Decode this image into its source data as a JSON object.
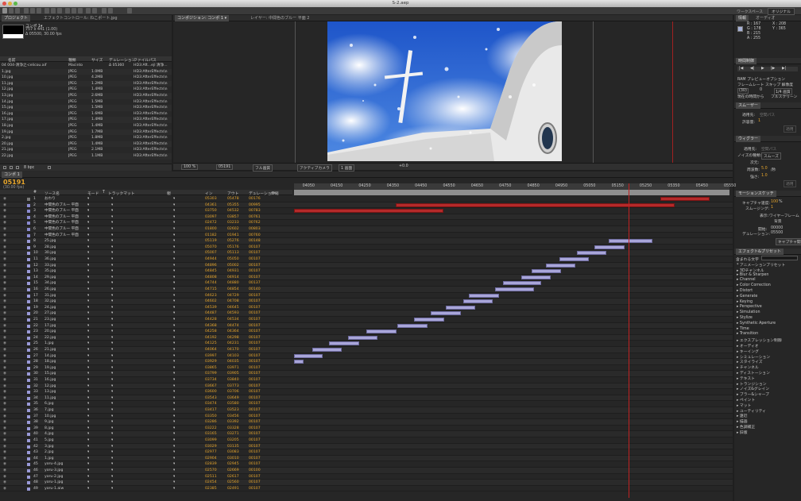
{
  "window": {
    "title": "S-2.aep"
  },
  "workspace": {
    "label": "ワークスペース",
    "value": "オリジナル"
  },
  "project_panel": {
    "tabs": [
      "プロジェクト",
      "エフェクトコントロール: ねこポート.jpg"
    ],
    "comp_name": "コンポ 1▾",
    "comp_size": "757 x 441 (1.00)",
    "comp_duration": "Δ 05500, 30.00 fps",
    "columns": [
      "名前",
      "種類",
      "サイズ",
      "デュレーション",
      "ファイルパス"
    ],
    "items": [
      {
        "name": "04 004-清浄之-celicou.aif",
        "type": "Macinto",
        "size": "  ",
        "dur": "Δ 05360",
        "path": "HD3:Aft...ejl 清浄..."
      },
      {
        "name": "1.jpg",
        "type": "JPEG",
        "size": "1.0MB",
        "dur": "",
        "path": "HD3:AfterEffects\\n"
      },
      {
        "name": "10.jpg",
        "type": "JPEG",
        "size": "4.2MB",
        "dur": "",
        "path": "HD3:AfterEffects\\n"
      },
      {
        "name": "11.jpg",
        "type": "JPEG",
        "size": "1.2MB",
        "dur": "",
        "path": "HD3:AfterEffects\\n"
      },
      {
        "name": "12.jpg",
        "type": "JPEG",
        "size": "1.4MB",
        "dur": "",
        "path": "HD3:AfterEffects\\n"
      },
      {
        "name": "13.jpg",
        "type": "JPEG",
        "size": "2.6MB",
        "dur": "",
        "path": "HD3:AfterEffects\\n"
      },
      {
        "name": "14.jpg",
        "type": "JPEG",
        "size": "1.5MB",
        "dur": "",
        "path": "HD3:AfterEffects\\n"
      },
      {
        "name": "15.jpg",
        "type": "JPEG",
        "size": "1.5MB",
        "dur": "",
        "path": "HD3:AfterEffects\\n"
      },
      {
        "name": "16.jpg",
        "type": "JPEG",
        "size": "1.6MB",
        "dur": "",
        "path": "HD3:AfterEffects\\n"
      },
      {
        "name": "17.jpg",
        "type": "JPEG",
        "size": "1.4MB",
        "dur": "",
        "path": "HD3:AfterEffects\\n"
      },
      {
        "name": "18.jpg",
        "type": "JPEG",
        "size": "1.4MB",
        "dur": "",
        "path": "HD3:AfterEffects\\n"
      },
      {
        "name": "19.jpg",
        "type": "JPEG",
        "size": "1.7MB",
        "dur": "",
        "path": "HD3:AfterEffects\\n"
      },
      {
        "name": "2.jpg",
        "type": "JPEG",
        "size": "1.8MB",
        "dur": "",
        "path": "HD3:AfterEffects\\n"
      },
      {
        "name": "20.jpg",
        "type": "JPEG",
        "size": "1.4MB",
        "dur": "",
        "path": "HD3:AfterEffects\\n"
      },
      {
        "name": "21.jpg",
        "type": "JPEG",
        "size": "2.1MB",
        "dur": "",
        "path": "HD3:AfterEffects\\n"
      },
      {
        "name": "22.jpg",
        "type": "JPEG",
        "size": "1.1MB",
        "dur": "",
        "path": "HD3:AfterEffects\\n"
      }
    ],
    "footer": "8 bpc"
  },
  "viewer": {
    "tabs": [
      "コンポジション: コンポ 1 ▾",
      "レイヤー: 中間色のブルー 平面 2"
    ],
    "zoom": "100 %",
    "timecode": "05191",
    "quality": "フル画質",
    "camera": "アクティブカメラ",
    "views": "1 画面",
    "exposure": "+0.0"
  },
  "info_panel": {
    "tabs": [
      "情報",
      "オーディオ"
    ],
    "r": "R : 167",
    "g": "G : 178",
    "b": "B : 215",
    "a": "A : 255",
    "x": "X : 208",
    "y": "Y : 365",
    "swatch": "#a7b2d7"
  },
  "time_panel": {
    "title": "時間制御",
    "ram_preview": "RAM プレビューオプション",
    "framerate_label": "フレームレート スキップ 解像度",
    "fr_value": "(30)",
    "skip_value": "0",
    "res_value": "1/4 画質",
    "current_time": "現在の時間から",
    "fullscreen": "フルスクリーン"
  },
  "smoother": {
    "title": "スムーザー",
    "apply_label": "適用先:",
    "apply_value": "空間パス",
    "tolerance_label": "許容量:",
    "tolerance_value": "1",
    "apply_btn": "適用"
  },
  "wiggler": {
    "title": "ウィグラー",
    "apply_to": "適用先:",
    "apply_to_value": "空間パス",
    "noise_type": "ノイズの種類:",
    "noise_value": "スムーズ",
    "dimension": "次元:",
    "freq_label": "周波数:",
    "freq_value": "5.0",
    "freq_unit": "/秒",
    "magnitude_label": "強さ:",
    "magnitude_value": "1.0",
    "apply_btn": "適用"
  },
  "motion_sketch": {
    "title": "モーションスケッチ",
    "capture_speed": "キャプチャ速度:",
    "capture_value": "100",
    "capture_unit": "%",
    "smoothing": "スムージング:",
    "smoothing_value": "1",
    "show": "表示:",
    "wireframe": "ワイヤーフレーム",
    "background": "背景",
    "start": "開始:",
    "start_value": "00000",
    "duration": "デュレーション:",
    "duration_value": "05500",
    "start_capture": "キャプチャ開始"
  },
  "effects_panel": {
    "title": "エフェクト&プリセット",
    "search_label": "含まれる文字",
    "items": [
      "* アニメーションプリセット",
      "▸ 3Dチャンネル",
      "▸ Blur & Sharpen",
      "▸ Channel",
      "▸ Color Correction",
      "▸ Distort",
      "▸ Generate",
      "▸ Keying",
      "▸ Perspective",
      "▸ Simulation",
      "▸ Stylize",
      "▸ Synthetic Aperture",
      "▸ Time",
      "▸ Transition",
      "▸ エクスプレッション制御",
      "▸ オーディオ",
      "▸ キーイング",
      "▸ シミュレーション",
      "▸ スタイライズ",
      "▸ チャンネル",
      "▸ ディストーション",
      "▸ テキスト",
      "▸ トランジション",
      "▸ ノイズ&グレイン",
      "▸ ブラー&シャープ",
      "▸ ペイント",
      "▸ マット",
      "▸ ユーティリティ",
      "▸ 遠近",
      "▸ 描画",
      "▸ 色調補正",
      "▸ 旧版"
    ]
  },
  "timeline": {
    "tab": "コンポ 1",
    "timecode": "05191",
    "fps": "(30.00 fps)",
    "columns": [
      "#",
      "ソース名",
      "モード",
      "T",
      "トラックマット",
      "親",
      "イン",
      "アウト",
      "デュレーション",
      "伸縮"
    ],
    "ruler": [
      "04050",
      "04150",
      "04250",
      "04350",
      "04450",
      "04550",
      "04650",
      "04750",
      "04850",
      "04950",
      "05050",
      "05150",
      "05250",
      "05350",
      "05450",
      "05550"
    ],
    "ruler_start": 4000,
    "ruler_end": 5550,
    "current_frame": 5191,
    "layers": [
      {
        "n": "1",
        "name": "おわり",
        "color": "#7a7a7a",
        "in": "05303",
        "out": "05478",
        "dur": "00176",
        "s": 5303,
        "e": 5478,
        "kind": "red"
      },
      {
        "n": "2",
        "name": "中間色のブルー 平面",
        "color": "#8a8ad0",
        "in": "04361",
        "out": "05355",
        "dur": "00995",
        "s": 4361,
        "e": 5355,
        "kind": "red"
      },
      {
        "n": "3",
        "name": "中間色のブルー 平面",
        "color": "#8a8ad0",
        "in": "03750",
        "out": "04532",
        "dur": "00783",
        "s": 4000,
        "e": 4532,
        "kind": "red"
      },
      {
        "n": "4",
        "name": "中間色のブルー 平面",
        "color": "#8a8ad0",
        "in": "03097",
        "out": "03857",
        "dur": "00761",
        "s": 0,
        "e": 0,
        "kind": "none"
      },
      {
        "n": "5",
        "name": "中間色のブルー 平面",
        "color": "#8a8ad0",
        "in": "02472",
        "out": "03233",
        "dur": "00762",
        "s": 0,
        "e": 0,
        "kind": "none"
      },
      {
        "n": "6",
        "name": "中間色のブルー 平面",
        "color": "#8a8ad0",
        "in": "01800",
        "out": "02602",
        "dur": "00803",
        "s": 0,
        "e": 0,
        "kind": "none"
      },
      {
        "n": "7",
        "name": "中間色のブルー 平面",
        "color": "#8a8ad0",
        "in": "01182",
        "out": "01941",
        "dur": "00760",
        "s": 0,
        "e": 0,
        "kind": "none"
      },
      {
        "n": "8",
        "name": "25.jpg",
        "color": "#9a9ad8",
        "in": "05119",
        "out": "05276",
        "dur": "00148",
        "s": 5119,
        "e": 5276,
        "kind": "lav"
      },
      {
        "n": "9",
        "name": "28.jpg",
        "color": "#9a9ad8",
        "in": "05070",
        "out": "05176",
        "dur": "00107",
        "s": 5070,
        "e": 5176,
        "kind": "lav"
      },
      {
        "n": "10",
        "name": "30.jpg",
        "color": "#9a9ad8",
        "in": "05007",
        "out": "05113",
        "dur": "00107",
        "s": 5007,
        "e": 5113,
        "kind": "lav"
      },
      {
        "n": "11",
        "name": "36.jpg",
        "color": "#9a9ad8",
        "in": "04944",
        "out": "05050",
        "dur": "00107",
        "s": 4944,
        "e": 5050,
        "kind": "lav"
      },
      {
        "n": "12",
        "name": "33.jpg",
        "color": "#9a9ad8",
        "in": "04896",
        "out": "05002",
        "dur": "00107",
        "s": 4896,
        "e": 5002,
        "kind": "lav"
      },
      {
        "n": "13",
        "name": "35.jpg",
        "color": "#9a9ad8",
        "in": "04845",
        "out": "04931",
        "dur": "00107",
        "s": 4845,
        "e": 4951,
        "kind": "lav"
      },
      {
        "n": "14",
        "name": "29.jpg",
        "color": "#9a9ad8",
        "in": "04808",
        "out": "04914",
        "dur": "00107",
        "s": 4808,
        "e": 4914,
        "kind": "lav"
      },
      {
        "n": "15",
        "name": "34.jpg",
        "color": "#9a9ad8",
        "in": "04744",
        "out": "04880",
        "dur": "00137",
        "s": 4744,
        "e": 4880,
        "kind": "lav"
      },
      {
        "n": "16",
        "name": "26.jpg",
        "color": "#9a9ad8",
        "in": "04715",
        "out": "04854",
        "dur": "00140",
        "s": 4715,
        "e": 4854,
        "kind": "lav"
      },
      {
        "n": "17",
        "name": "31.jpg",
        "color": "#9a9ad8",
        "in": "04623",
        "out": "04729",
        "dur": "00107",
        "s": 4623,
        "e": 4729,
        "kind": "lav"
      },
      {
        "n": "18",
        "name": "32.jpg",
        "color": "#9a9ad8",
        "in": "04602",
        "out": "04708",
        "dur": "00107",
        "s": 4602,
        "e": 4708,
        "kind": "lav"
      },
      {
        "n": "19",
        "name": "24.jpg",
        "color": "#9a9ad8",
        "in": "04539",
        "out": "04645",
        "dur": "00107",
        "s": 4539,
        "e": 4645,
        "kind": "lav"
      },
      {
        "n": "20",
        "name": "27.jpg",
        "color": "#9a9ad8",
        "in": "04487",
        "out": "04593",
        "dur": "00107",
        "s": 4487,
        "e": 4593,
        "kind": "lav"
      },
      {
        "n": "21",
        "name": "23.jpg",
        "color": "#9a9ad8",
        "in": "04428",
        "out": "04534",
        "dur": "00107",
        "s": 4428,
        "e": 4534,
        "kind": "lav"
      },
      {
        "n": "22",
        "name": "17.jpg",
        "color": "#9a9ad8",
        "in": "04368",
        "out": "04474",
        "dur": "00107",
        "s": 4368,
        "e": 4474,
        "kind": "lav"
      },
      {
        "n": "23",
        "name": "20.jpg",
        "color": "#9a9ad8",
        "in": "04258",
        "out": "04364",
        "dur": "00107",
        "s": 4258,
        "e": 4364,
        "kind": "lav"
      },
      {
        "n": "24",
        "name": "22.jpg",
        "color": "#9a9ad8",
        "in": "04192",
        "out": "04298",
        "dur": "00107",
        "s": 4192,
        "e": 4298,
        "kind": "lav"
      },
      {
        "n": "25",
        "name": "1.jpg",
        "color": "#9a9ad8",
        "in": "04125",
        "out": "04231",
        "dur": "00107",
        "s": 4125,
        "e": 4231,
        "kind": "lav"
      },
      {
        "n": "26",
        "name": "21.jpg",
        "color": "#9a9ad8",
        "in": "04064",
        "out": "04170",
        "dur": "00107",
        "s": 4064,
        "e": 4170,
        "kind": "lav"
      },
      {
        "n": "27",
        "name": "14.jpg",
        "color": "#9a9ad8",
        "in": "03997",
        "out": "04103",
        "dur": "00107",
        "s": 3997,
        "e": 4103,
        "kind": "lav"
      },
      {
        "n": "28",
        "name": "18.jpg",
        "color": "#9a9ad8",
        "in": "03929",
        "out": "04035",
        "dur": "00107",
        "s": 3929,
        "e": 4035,
        "kind": "lav"
      },
      {
        "n": "29",
        "name": "19.jpg",
        "color": "#9a9ad8",
        "in": "03865",
        "out": "03971",
        "dur": "00107",
        "s": 0,
        "e": 0,
        "kind": "none"
      },
      {
        "n": "30",
        "name": "15.jpg",
        "color": "#9a9ad8",
        "in": "03799",
        "out": "03905",
        "dur": "00107",
        "s": 0,
        "e": 0,
        "kind": "none"
      },
      {
        "n": "31",
        "name": "16.jpg",
        "color": "#9a9ad8",
        "in": "03734",
        "out": "03840",
        "dur": "00107",
        "s": 0,
        "e": 0,
        "kind": "none"
      },
      {
        "n": "32",
        "name": "12.jpg",
        "color": "#9a9ad8",
        "in": "03667",
        "out": "03773",
        "dur": "00107",
        "s": 0,
        "e": 0,
        "kind": "none"
      },
      {
        "n": "33",
        "name": "13.jpg",
        "color": "#9a9ad8",
        "in": "03600",
        "out": "03706",
        "dur": "00107",
        "s": 0,
        "e": 0,
        "kind": "none"
      },
      {
        "n": "34",
        "name": "11.jpg",
        "color": "#9a9ad8",
        "in": "03543",
        "out": "03649",
        "dur": "00107",
        "s": 0,
        "e": 0,
        "kind": "none"
      },
      {
        "n": "35",
        "name": "6.jpg",
        "color": "#9a9ad8",
        "in": "03474",
        "out": "03580",
        "dur": "00107",
        "s": 0,
        "e": 0,
        "kind": "none"
      },
      {
        "n": "36",
        "name": "7.jpg",
        "color": "#9a9ad8",
        "in": "03417",
        "out": "03523",
        "dur": "00107",
        "s": 0,
        "e": 0,
        "kind": "none"
      },
      {
        "n": "37",
        "name": "10.jpg",
        "color": "#9a9ad8",
        "in": "03350",
        "out": "03456",
        "dur": "00107",
        "s": 0,
        "e": 0,
        "kind": "none"
      },
      {
        "n": "38",
        "name": "9.jpg",
        "color": "#9a9ad8",
        "in": "03286",
        "out": "03392",
        "dur": "00107",
        "s": 0,
        "e": 0,
        "kind": "none"
      },
      {
        "n": "39",
        "name": "8.jpg",
        "color": "#9a9ad8",
        "in": "03222",
        "out": "03328",
        "dur": "00107",
        "s": 0,
        "e": 0,
        "kind": "none"
      },
      {
        "n": "40",
        "name": "4.jpg",
        "color": "#9a9ad8",
        "in": "03165",
        "out": "03271",
        "dur": "00107",
        "s": 0,
        "e": 0,
        "kind": "none"
      },
      {
        "n": "41",
        "name": "5.jpg",
        "color": "#9a9ad8",
        "in": "03099",
        "out": "03205",
        "dur": "00107",
        "s": 0,
        "e": 0,
        "kind": "none"
      },
      {
        "n": "42",
        "name": "3.jpg",
        "color": "#9a9ad8",
        "in": "03029",
        "out": "03135",
        "dur": "00107",
        "s": 0,
        "e": 0,
        "kind": "none"
      },
      {
        "n": "43",
        "name": "2.jpg",
        "color": "#9a9ad8",
        "in": "02977",
        "out": "03083",
        "dur": "00107",
        "s": 0,
        "e": 0,
        "kind": "none"
      },
      {
        "n": "44",
        "name": "1.jpg",
        "color": "#9a9ad8",
        "in": "02904",
        "out": "03010",
        "dur": "00107",
        "s": 0,
        "e": 0,
        "kind": "none"
      },
      {
        "n": "45",
        "name": "yoru-4.jpg",
        "color": "#9a9ad8",
        "in": "02839",
        "out": "02945",
        "dur": "00107",
        "s": 0,
        "e": 0,
        "kind": "none"
      },
      {
        "n": "46",
        "name": "yoru-3.jpg",
        "color": "#9a9ad8",
        "in": "02570",
        "out": "02669",
        "dur": "00100",
        "s": 0,
        "e": 0,
        "kind": "none"
      },
      {
        "n": "47",
        "name": "yoru-2.jpg",
        "color": "#9a9ad8",
        "in": "02511",
        "out": "02617",
        "dur": "00107",
        "s": 0,
        "e": 0,
        "kind": "none"
      },
      {
        "n": "48",
        "name": "yoru-1.jpg",
        "color": "#9a9ad8",
        "in": "02454",
        "out": "02560",
        "dur": "00107",
        "s": 0,
        "e": 0,
        "kind": "none"
      },
      {
        "n": "49",
        "name": "yoru-1.aiw",
        "color": "#9a9ad8",
        "in": "02385",
        "out": "02491",
        "dur": "00107",
        "s": 0,
        "e": 0,
        "kind": "none"
      }
    ]
  }
}
